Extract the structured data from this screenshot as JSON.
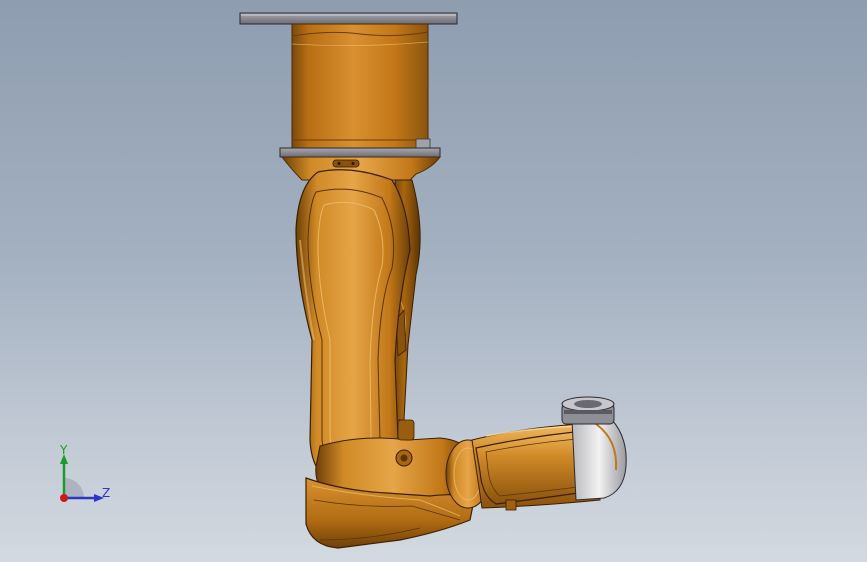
{
  "triad": {
    "y_label": "Y",
    "z_label": "Z",
    "y_color": "#1c9a2a",
    "z_color": "#2a36c8",
    "x_color": "#d01818"
  },
  "model": {
    "primary_color": "#c07818",
    "highlight_color": "#e8a848",
    "shadow_color": "#5a3406",
    "base_plate_color": "#8d8d94"
  }
}
